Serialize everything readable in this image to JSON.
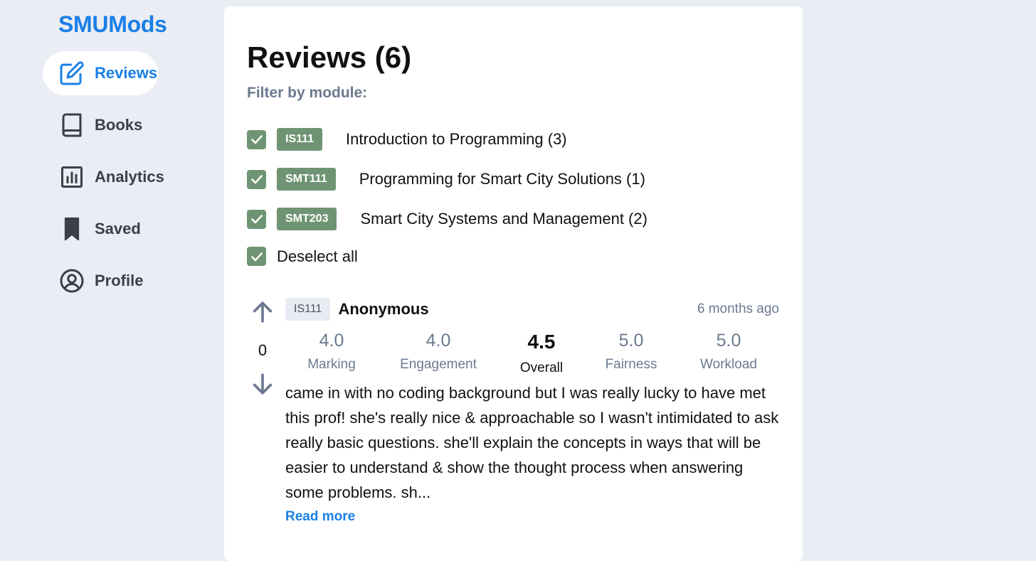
{
  "app": {
    "brand": "SMUMods"
  },
  "sidebar": {
    "items": [
      {
        "label": "Reviews",
        "icon": "edit-icon",
        "active": true
      },
      {
        "label": "Books",
        "icon": "book-icon",
        "active": false
      },
      {
        "label": "Analytics",
        "icon": "bar-chart-icon",
        "active": false
      },
      {
        "label": "Saved",
        "icon": "bookmark-icon",
        "active": false
      },
      {
        "label": "Profile",
        "icon": "user-circle-icon",
        "active": false
      }
    ]
  },
  "main": {
    "title": "Reviews (6)",
    "filter_label": "Filter by module:",
    "filters": [
      {
        "code": "IS111",
        "name": "Introduction to Programming (3)",
        "checked": true
      },
      {
        "code": "SMT111",
        "name": "Programming for Smart City Solutions (1)",
        "checked": true
      },
      {
        "code": "SMT203",
        "name": "Smart City Systems and Management (2)",
        "checked": true
      }
    ],
    "deselect_all": {
      "label": "Deselect all",
      "checked": true
    }
  },
  "review": {
    "votes": "0",
    "module": "IS111",
    "author": "Anonymous",
    "time": "6 months ago",
    "ratings": [
      {
        "value": "4.0",
        "label": "Marking"
      },
      {
        "value": "4.0",
        "label": "Engagement"
      },
      {
        "value": "4.5",
        "label": "Overall"
      },
      {
        "value": "5.0",
        "label": "Fairness"
      },
      {
        "value": "5.0",
        "label": "Workload"
      }
    ],
    "text": "came in with no coding background but I was really lucky to have met this prof! she's really nice & approachable so I wasn't intimidated to ask really basic questions. she'll explain the concepts in ways that will be easier to understand & show the thought process when answering some problems. sh...",
    "read_more": "Read more"
  },
  "colors": {
    "accent": "#1a7fe6",
    "tag_green": "#6f9473",
    "muted": "#6b7a90",
    "background": "#eaedf3"
  }
}
